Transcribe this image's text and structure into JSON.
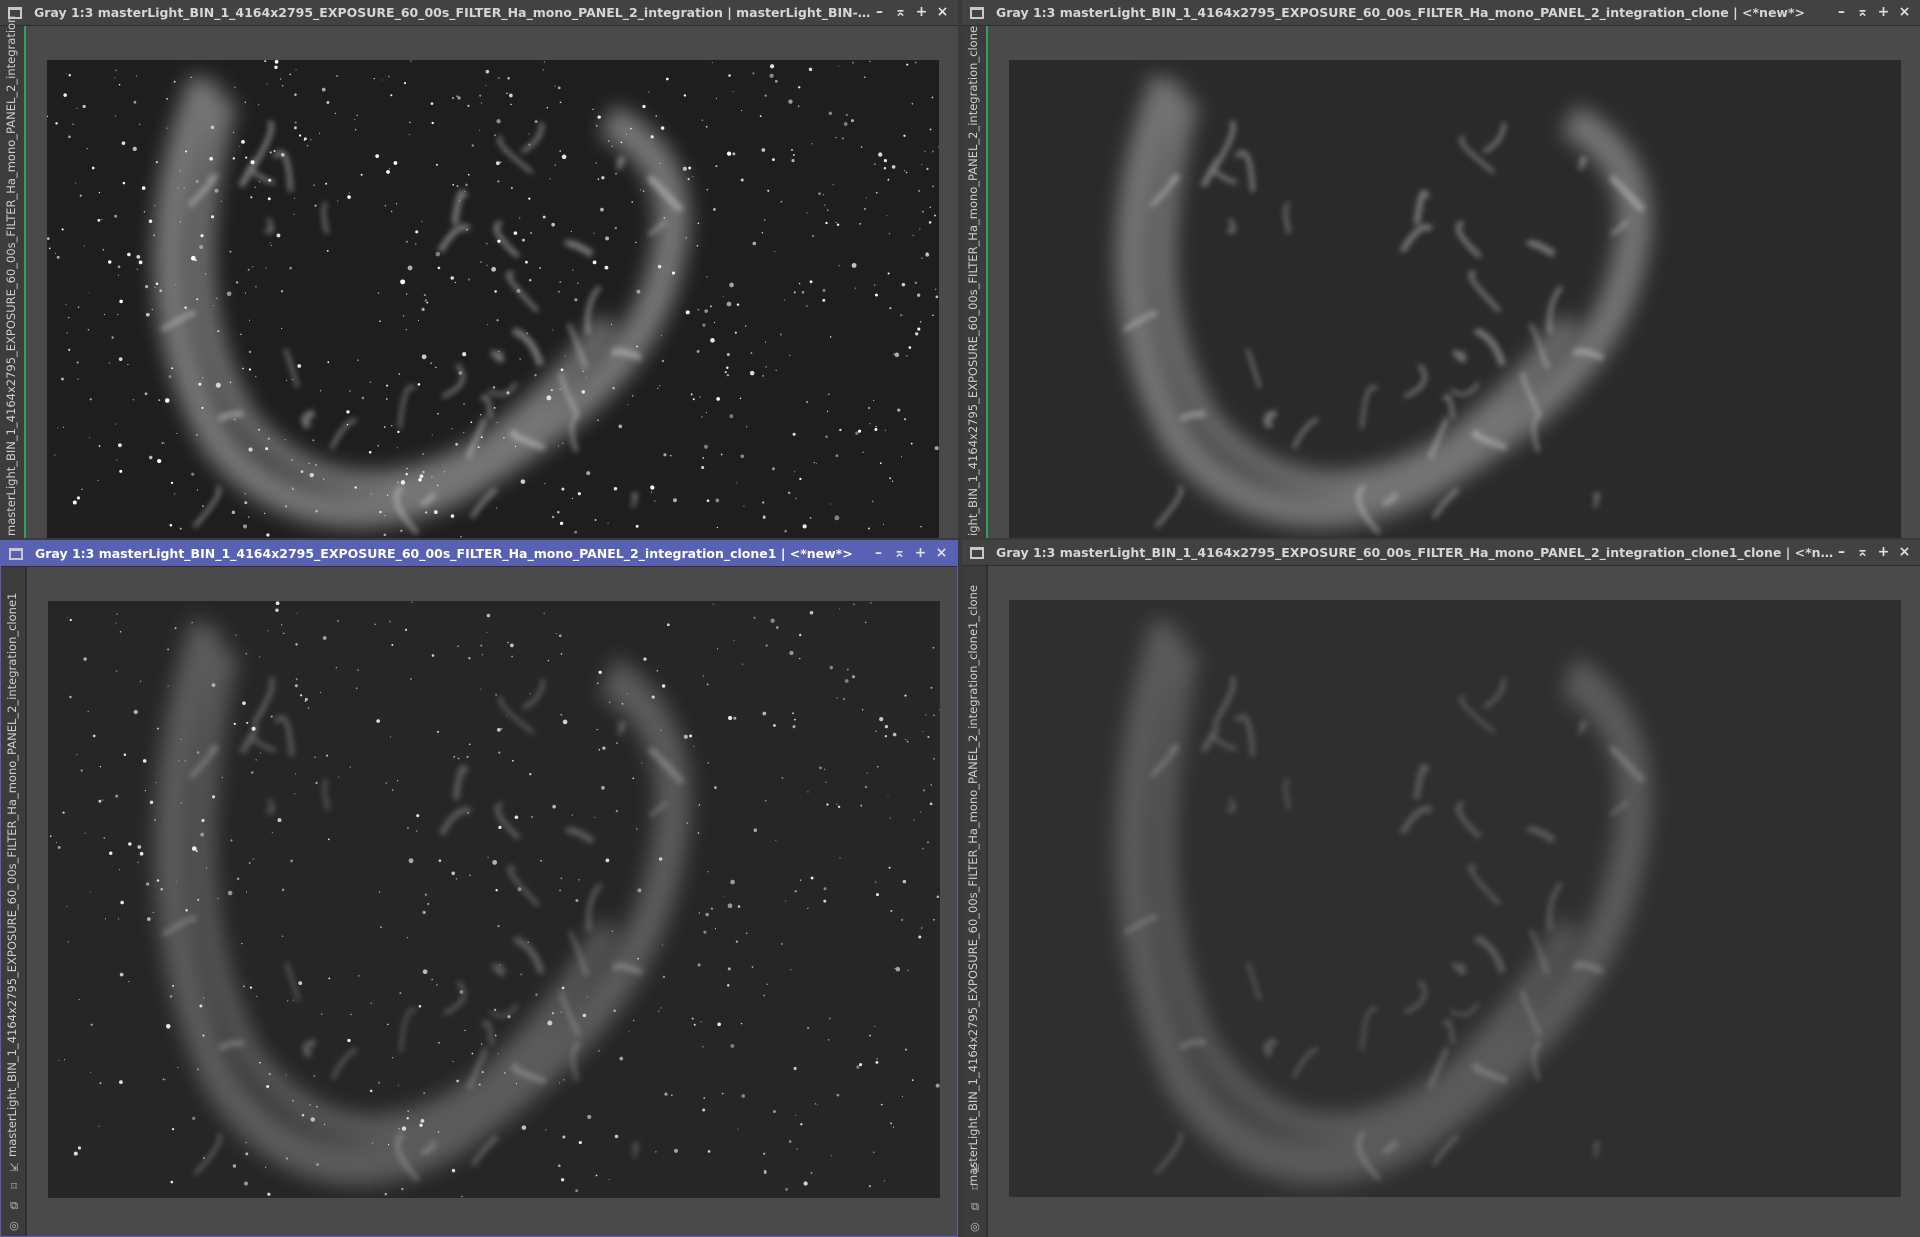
{
  "windows": [
    {
      "id": "tl",
      "title": "Gray 1:3 masterLight_BIN_1_4164x2795_EXPOSURE_60_00s_FILTER_Ha_mono_PANEL_2_integration | masterLight_BIN-...",
      "side_label": "masterLight_BIN_1_4164x2795_EXPOSURE_60_00s_FILTER_Ha_mono_PANEL_2_integration",
      "active": false
    },
    {
      "id": "tr",
      "title": "Gray 1:3 masterLight_BIN_1_4164x2795_EXPOSURE_60_00s_FILTER_Ha_mono_PANEL_2_integration_clone | <*new*>",
      "side_label": "ight_BIN_1_4164x2795_EXPOSURE_60_00s_FILTER_Ha_mono_PANEL_2_integration_clone",
      "active": false
    },
    {
      "id": "bl",
      "title": "Gray 1:3 masterLight_BIN_1_4164x2795_EXPOSURE_60_00s_FILTER_Ha_mono_PANEL_2_integration_clone1 | <*new*>",
      "side_label": "masterLight_BIN_1_4164x2795_EXPOSURE_60_00s_FILTER_Ha_mono_PANEL_2_integration_clone1",
      "active": true
    },
    {
      "id": "br",
      "title": "Gray 1:3 masterLight_BIN_1_4164x2795_EXPOSURE_60_00s_FILTER_Ha_mono_PANEL_2_integration_clone1_clone | <*n...",
      "side_label": "masterLight_BIN_1_4164x2795_EXPOSURE_60_00s_FILTER_Ha_mono_PANEL_2_integration_clone1_clone",
      "active": false
    }
  ],
  "buttons": {
    "minimize": "–",
    "shade": "⌅",
    "maximize": "+",
    "close": "×"
  },
  "icons": {
    "window_icon": "image-window-icon",
    "side_tools": [
      "zoom-icon",
      "fit-icon",
      "clone-icon",
      "target-icon"
    ]
  },
  "colors": {
    "active_title": "#5861b3",
    "green_link": "#2fa35a"
  }
}
